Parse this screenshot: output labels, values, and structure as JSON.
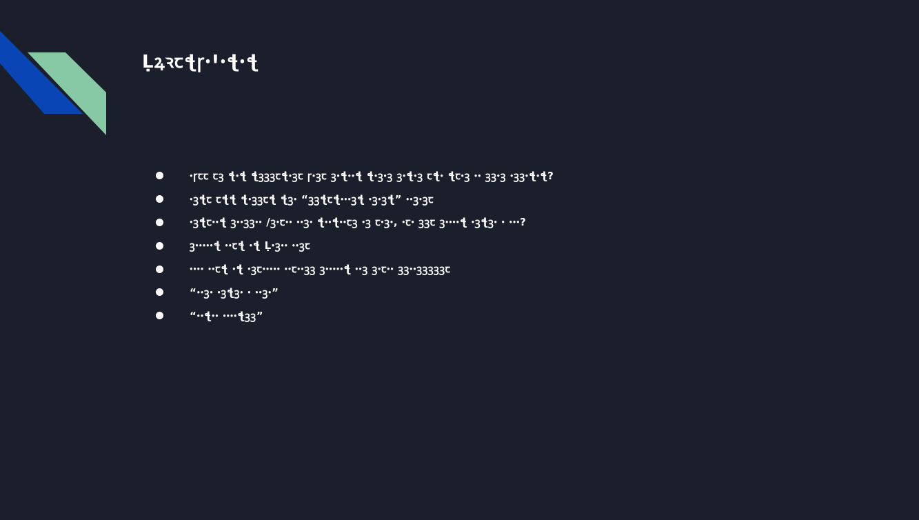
{
  "slide": {
    "title": "ḶꝝꝛꞇꞎꞅꞏꞋꞏꞎꞏꞎ",
    "colors": {
      "background": "#1b1f2b",
      "stripe_blue": "#0a45b5",
      "stripe_green": "#86c9a4",
      "text": "#ffffff"
    },
    "bullets": [
      {
        "text": "ꞏꞅꞇꞇ ꞇꝫ ꞎꞏꞎ ꞎꝫꝫꝫꞇꞎꞏꝫꞇ ꞅꞏꝫꞇ ꝫꞏꞎꞏꞏꞎ ꞎꞏꝫꞏꝫ ꝫꞏꞎꞏꝫ ꞇꞎꞏ ꞎꞇꞏꝫ ꞏꞏ ꝫꝫꞏꝫ ꞏꝫꝫꞏꞎꞏꞎ?"
      },
      {
        "text": "ꞏꝫꞎꞇ ꞇꞎꞎ ꞎꞏꝫꝫꞇꞎ ꞎꝫꞏ “ꝫꝫꞎꞇꞎꞏꞏꞏꝫꞎ ꞏꝫꞏꝫꞎ” ꞏꞏꝫꞏꝫꞇ"
      },
      {
        "text": "ꞏꝫꞎꞇꞏꞏꞎ ꝫꞏꞏꝫꝫꞏꞏ /ꝫꞏꞇꞏꞏ ꞏꞏꝫꞏ ꞎꞏꞏꞎꞏꞏꞇꝫ ꞏꝫ ꞇꞏꝫꞏ, ꞏꞇꞏ ꝫꝫꞇ ꝫꞏꞏꞏꞏꞎ ꞏꝫꞎꝫꞏ ꞏ ꞏꞏꞏ?"
      },
      {
        "text": "ꝫꞏꞏꞏꞏꞏꞎ ꞏꞏꞇꞎ ꞏꞎ Ḷꞏꝫꞏꞏ ꞏꞏꝫꞇ"
      },
      {
        "text": "ꞏꞏꞏꞏ ꞏꞏꞇꞎ ꞏꞎ ꞏꝫꞇꞏꞏꞏꞏꞏ ꞏꞏꞇꞏꞏꝫꝫ ꝫꞏꞏꞏꞏꞏꞎ ꞏꞏꝫ ꝫꞏꞇꞏꞏ ꝫꝫꞏꞏꝫꝫꝫꝫꝫꞇ"
      },
      {
        "text": "“ꞏꞏꝫꞏ ꞏꝫꞎꝫꞏ ꞏ ꞏꞏꝫꞏ”"
      },
      {
        "text": "“ꞏꞏꞎꞏꞏ ꞏꞏꞏꞏꞎꝫꝫ”"
      }
    ]
  }
}
